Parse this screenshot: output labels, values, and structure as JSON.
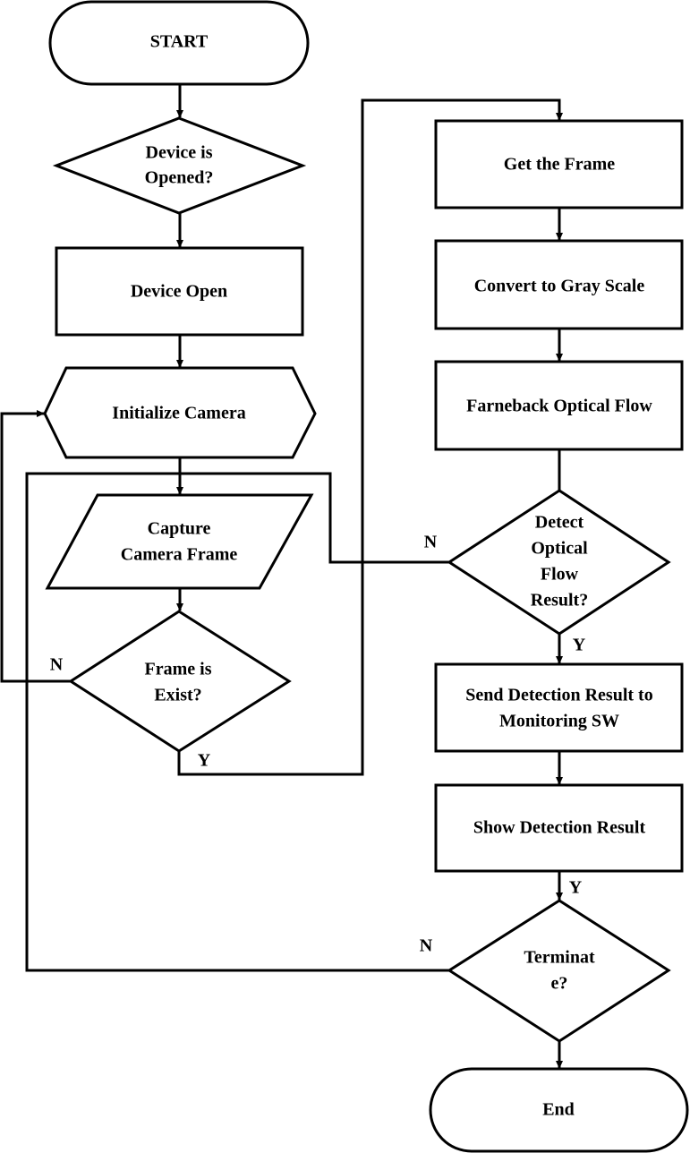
{
  "nodes": {
    "start": "START",
    "device_opened": [
      "Device is",
      "Opened?"
    ],
    "device_open": "Device Open",
    "init_camera": "Initialize Camera",
    "capture": [
      "Capture",
      "Camera Frame"
    ],
    "frame_exist": [
      "Frame is",
      "Exist?"
    ],
    "get_frame": "Get the Frame",
    "gray": "Convert to Gray Scale",
    "farneback": "Farneback Optical Flow",
    "detect": [
      "Detect",
      "Optical",
      "Flow",
      "Result?"
    ],
    "send": [
      "Send Detection Result to",
      "Monitoring SW"
    ],
    "show": "Show Detection Result",
    "terminate": [
      "Terminat",
      "e?"
    ],
    "end": "End"
  },
  "labels": {
    "frame_no": "N",
    "frame_yes": "Y",
    "detect_no": "N",
    "detect_yes": "Y",
    "show_yes": "Y",
    "terminate_no": "N"
  }
}
